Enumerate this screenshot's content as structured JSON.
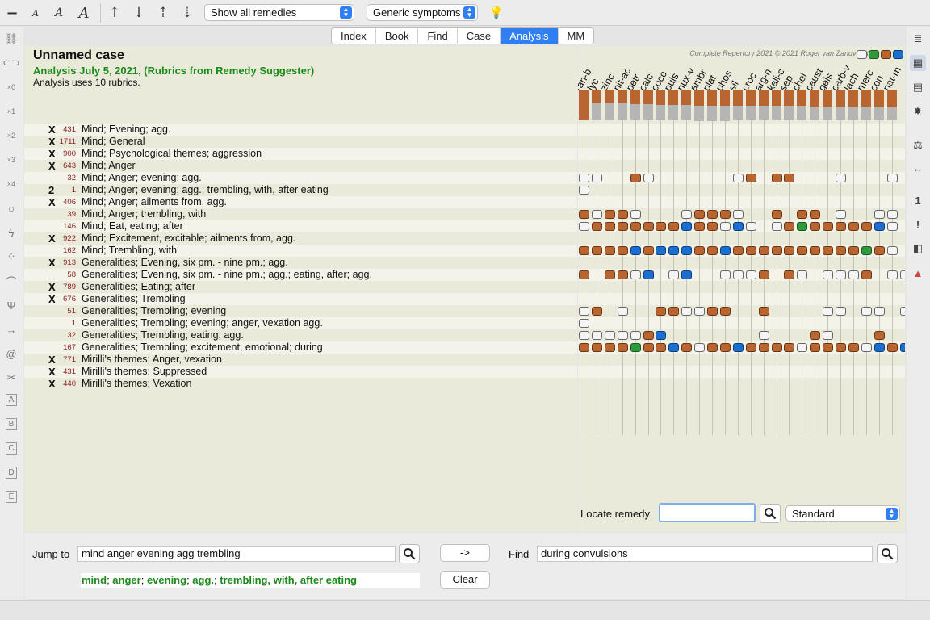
{
  "toolbar": {
    "remedy_filter": "Show all remedies",
    "symptom_filter": "Generic symptoms"
  },
  "tabs": [
    {
      "label": "Index",
      "active": false
    },
    {
      "label": "Book",
      "active": false
    },
    {
      "label": "Find",
      "active": false
    },
    {
      "label": "Case",
      "active": false
    },
    {
      "label": "Analysis",
      "active": true
    },
    {
      "label": "MM",
      "active": false
    }
  ],
  "case": {
    "title": "Unnamed case",
    "analysis_line": "Analysis July 5, 2021, (Rubrics from Remedy Suggester)",
    "note": "Analysis uses 10 rubrics."
  },
  "copyright": "Complete Repertory 2021 © 2021 Roger van Zandvoort",
  "left_tools": [
    "link-icon",
    "unlink-icon",
    "x0",
    "x1",
    "x2",
    "x3",
    "x4",
    "circle-icon",
    "lightning-icon",
    "dots-icon",
    "arch-icon",
    "fork-icon",
    "arrow-right-icon",
    "spiral-icon",
    "cross-icon",
    "A",
    "B",
    "C",
    "D",
    "E"
  ],
  "left_tool_labels": {
    "x0": "×0",
    "x1": "×1",
    "x2": "×2",
    "x3": "×3",
    "x4": "×4",
    "A": "A",
    "B": "B",
    "C": "C",
    "D": "D",
    "E": "E"
  },
  "rubrics": [
    {
      "mark": "X",
      "count": "431",
      "text": "Mind; Evening; agg."
    },
    {
      "mark": "X",
      "count": "1711",
      "text": "Mind; General"
    },
    {
      "mark": "X",
      "count": "900",
      "text": "Mind; Psychological themes; aggression"
    },
    {
      "mark": "X",
      "count": "643",
      "text": "Mind; Anger"
    },
    {
      "mark": "",
      "count": "32",
      "text": "Mind; Anger; evening; agg."
    },
    {
      "mark": "2",
      "count": "1",
      "text": "Mind; Anger; evening; agg.; trembling, with, after eating"
    },
    {
      "mark": "X",
      "count": "406",
      "text": "Mind; Anger; ailments from, agg."
    },
    {
      "mark": "",
      "count": "39",
      "text": "Mind; Anger; trembling, with"
    },
    {
      "mark": "",
      "count": "146",
      "text": "Mind; Eat, eating; after"
    },
    {
      "mark": "X",
      "count": "922",
      "text": "Mind; Excitement, excitable; ailments from, agg."
    },
    {
      "mark": "",
      "count": "162",
      "text": "Mind; Trembling, with"
    },
    {
      "mark": "X",
      "count": "913",
      "text": "Generalities; Evening, six pm. - nine pm.; agg."
    },
    {
      "mark": "",
      "count": "58",
      "text": "Generalities; Evening, six pm. - nine pm.; agg.; eating, after; agg."
    },
    {
      "mark": "X",
      "count": "789",
      "text": "Generalities; Eating; after"
    },
    {
      "mark": "X",
      "count": "676",
      "text": "Generalities; Trembling"
    },
    {
      "mark": "",
      "count": "51",
      "text": "Generalities; Trembling; evening"
    },
    {
      "mark": "",
      "count": "1",
      "text": "Generalities; Trembling; evening; anger, vexation agg."
    },
    {
      "mark": "",
      "count": "32",
      "text": "Generalities; Trembling; eating; agg."
    },
    {
      "mark": "",
      "count": "167",
      "text": "Generalities; Trembling; excitement, emotional; during"
    },
    {
      "mark": "X",
      "count": "771",
      "text": "Mirilli's themes; Anger, vexation"
    },
    {
      "mark": "X",
      "count": "431",
      "text": "Mirilli's themes; Suppressed"
    },
    {
      "mark": "X",
      "count": "440",
      "text": "Mirilli's themes; Vexation"
    }
  ],
  "remedies": [
    "ran-b",
    "lyc",
    "zinc",
    "nit-ac",
    "petr",
    "calc",
    "cocc",
    "puls",
    "nux-v",
    "ambr",
    "plat",
    "phos",
    "sil",
    "croc",
    "arg-n",
    "kali-c",
    "sep",
    "chel",
    "caust",
    "gels",
    "carb-v",
    "lach",
    "merc",
    "con",
    "nat-m"
  ],
  "remedy_score_fraction": [
    0.82,
    0.58,
    0.58,
    0.58,
    0.55,
    0.55,
    0.52,
    0.52,
    0.52,
    0.5,
    0.5,
    0.5,
    0.48,
    0.48,
    0.48,
    0.48,
    0.48,
    0.48,
    0.45,
    0.45,
    0.45,
    0.45,
    0.45,
    0.42,
    0.42
  ],
  "grid": [
    "",
    "",
    "",
    "",
    "ww  bw      wb bb   w   w ",
    "w                        ",
    "",
    "bwbbw   wbbbw  b bb w  ww ",
    "wbbbbbbbubbwuw wbgbbbbbuw ",
    "",
    "bbbbubuuubbubbbbbbbbbbgbw ",
    "",
    "b bbwu wu  wwwb bw wwwb ww",
    "",
    "",
    "wb w  bbwwbb  b    ww ww w",
    "w                        ",
    "wwwwwbu       w   bw   b  ",
    "bbbbgbbubwbbubbbbwbbbbwubu",
    "",
    "",
    ""
  ],
  "locate": {
    "label": "Locate remedy",
    "value": "",
    "mode": "Standard"
  },
  "bottom": {
    "jump_label": "Jump to",
    "jump_value": "mind anger evening agg trembling",
    "arrow_label": "->",
    "find_label": "Find",
    "find_value": "during convulsions",
    "clear_label": "Clear",
    "hint_parts": [
      "mind",
      "anger",
      "evening",
      "agg.",
      "trembling, with, after eating"
    ]
  }
}
